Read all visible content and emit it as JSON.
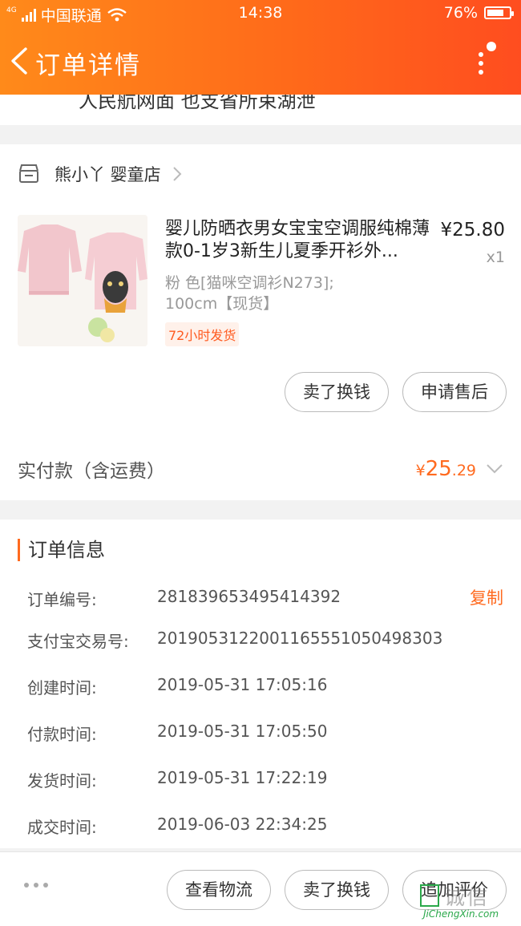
{
  "status_bar": {
    "carrier": "中国联通",
    "network": "4G",
    "time": "14:38",
    "battery": "76%"
  },
  "nav": {
    "title": "订单详情"
  },
  "address_peek": "人民航网面 也支省所束湖泄",
  "shop": {
    "name": "熊小丫 婴童店"
  },
  "product": {
    "title": "婴儿防晒衣男女宝宝空调服纯棉薄款0-1岁3新生儿夏季开衫外...",
    "price": "¥25.80",
    "qty": "x1",
    "spec_line1": "粉 色[猫咪空调衫N273];",
    "spec_line2": "100cm【现货】",
    "ship_tag": "72小时发货"
  },
  "item_buttons": {
    "sell": "卖了换钱",
    "after_sale": "申请售后"
  },
  "payment": {
    "label": "实付款（含运费）",
    "currency": "¥",
    "integer": "25",
    "decimal": ".29"
  },
  "order_info": {
    "title": "订单信息",
    "copy_label": "复制",
    "rows": [
      {
        "key": "订单编号:",
        "value": "281839653495414392"
      },
      {
        "key": "支付宝交易号:",
        "value": "2019053122001165551050498303"
      },
      {
        "key": "创建时间:",
        "value": "2019-05-31 17:05:16"
      },
      {
        "key": "付款时间:",
        "value": "2019-05-31 17:05:50"
      },
      {
        "key": "发货时间:",
        "value": "2019-05-31 17:22:19"
      },
      {
        "key": "成交时间:",
        "value": "2019-06-03 22:34:25"
      }
    ]
  },
  "bottom_bar": {
    "logistics": "查看物流",
    "sell": "卖了换钱",
    "review": "追加评价"
  },
  "watermark": {
    "cn": "诚信",
    "en": "JiChengXin.com"
  },
  "colors": {
    "accent": "#ff6a1f",
    "header_start": "#ff8a1a",
    "header_end": "#ff4d1f"
  }
}
